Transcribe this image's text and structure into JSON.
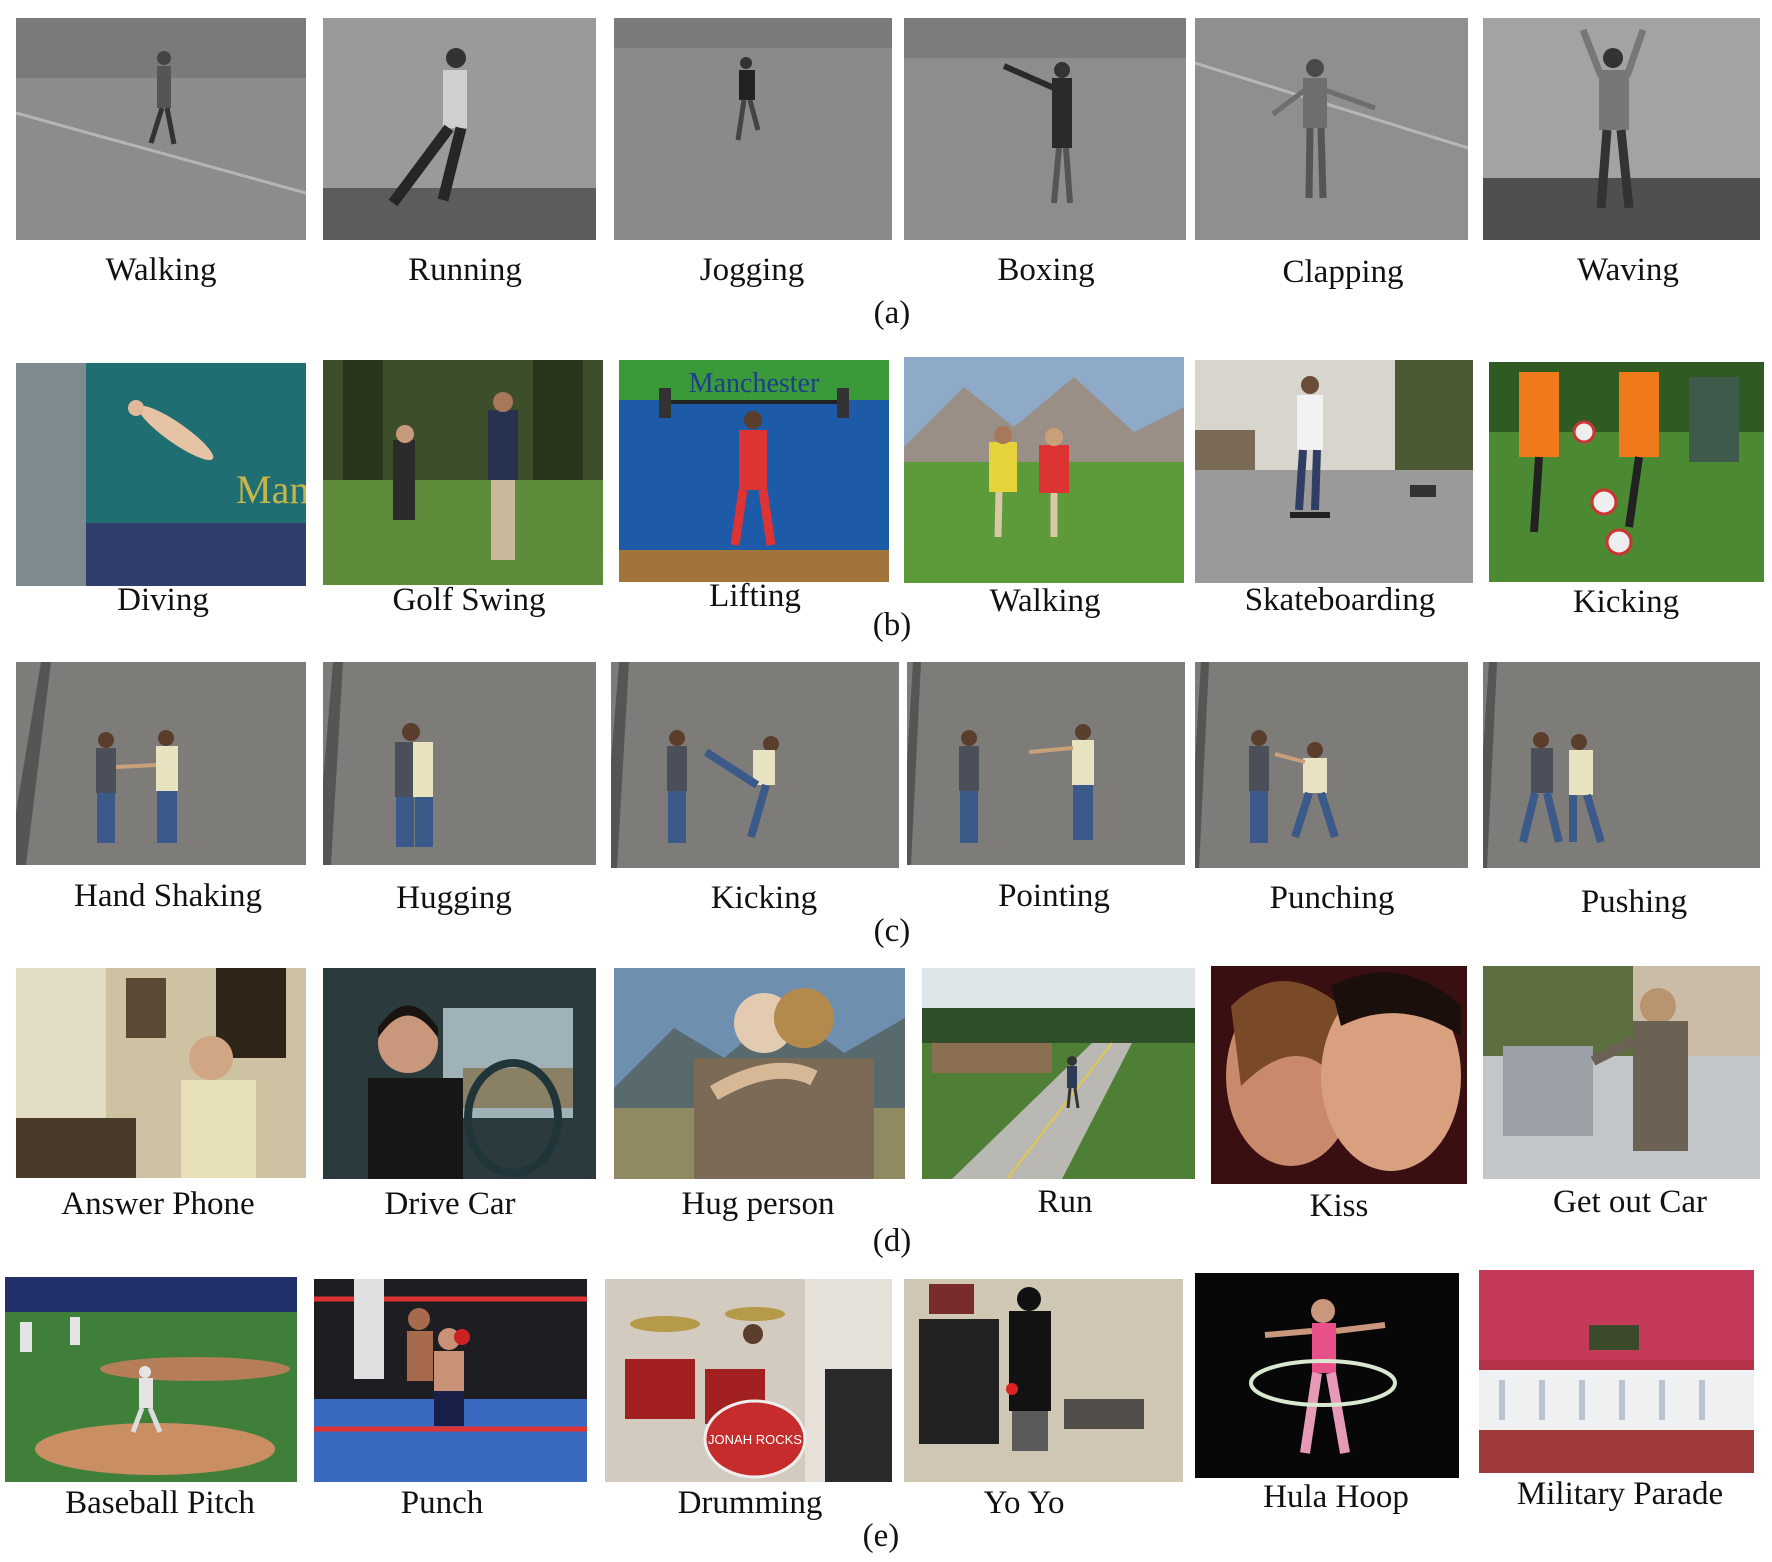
{
  "rows": [
    {
      "label": "(a)",
      "captions": [
        "Walking",
        "Running",
        "Jogging",
        "Boxing",
        "Clapping",
        "Waving"
      ]
    },
    {
      "label": "(b)",
      "captions": [
        "Diving",
        "Golf Swing",
        "Lifting",
        "Walking",
        "Skateboarding",
        "Kicking"
      ]
    },
    {
      "label": "(c)",
      "captions": [
        "Hand Shaking",
        "Hugging",
        "Kicking",
        "Pointing",
        "Punching",
        "Pushing"
      ]
    },
    {
      "label": "(d)",
      "captions": [
        "Answer Phone",
        "Drive Car",
        "Hug person",
        "Run",
        "Kiss",
        "Get out Car"
      ]
    },
    {
      "label": "(e)",
      "captions": [
        "Baseball Pitch",
        "Punch",
        "Drumming",
        "Yo Yo",
        "Hula Hoop",
        "Military Parade"
      ]
    }
  ],
  "image_text": {
    "lifting_banner": "Manchester",
    "drum_logo": "JONAH ROCKS"
  }
}
